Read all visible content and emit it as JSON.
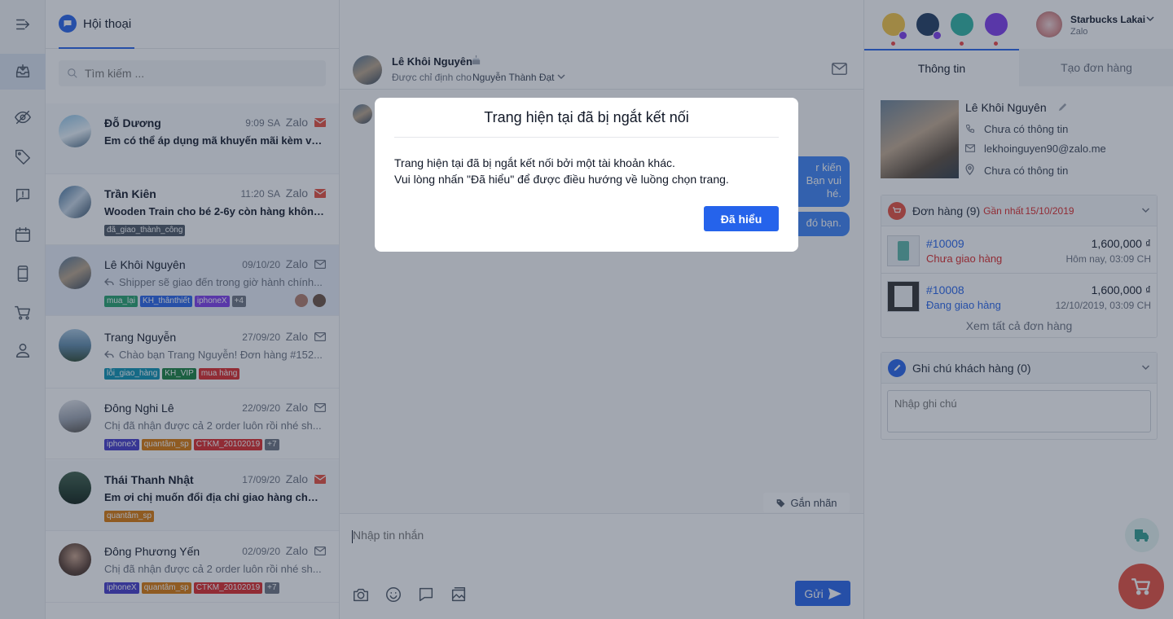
{
  "header": {
    "tab_label": "Hội thoại",
    "account_name": "Starbucks Lakai",
    "account_channel": "Zalo"
  },
  "search": {
    "placeholder": "Tìm kiếm ..."
  },
  "conversations": [
    {
      "name": "Đỗ Dương",
      "time": "9:09 SA",
      "source": "Zalo",
      "message": "Em có thể áp dụng mã khuyến mãi kèm với...",
      "unread": true,
      "tags": []
    },
    {
      "name": "Trần Kiên",
      "time": "11:20 SA",
      "source": "Zalo",
      "message": "Wooden Train cho bé 2-6y còn hàng không...",
      "unread": true,
      "tags": [
        "đã_giao_thành_công"
      ]
    },
    {
      "name": "Lê Khôi Nguyên",
      "time": "09/10/20",
      "source": "Zalo",
      "message": "Shipper sẽ giao đến trong giờ hành chính...",
      "unread": false,
      "tags": [
        "mua_lại",
        "KH_thânthiết",
        "iphoneX",
        "+4"
      ]
    },
    {
      "name": "Trang Nguyễn",
      "time": "27/09/20",
      "source": "Zalo",
      "message": "Chào bạn Trang Nguyễn! Đơn hàng #152...",
      "unread": false,
      "tags": [
        "lỗi_giao_hàng",
        "KH_VIP",
        "mua hàng"
      ]
    },
    {
      "name": "Đông Nghi Lê",
      "time": "22/09/20",
      "source": "Zalo",
      "message": "Chị đã nhận được cả 2 order luôn rồi nhé sh...",
      "unread": false,
      "tags": [
        "iphoneX",
        "quantâm_sp",
        "CTKM_20102019",
        "+7"
      ]
    },
    {
      "name": "Thái Thanh Nhật",
      "time": "17/09/20",
      "source": "Zalo",
      "message": "Em ơi chị muốn đổi địa chỉ giao hàng cho đơ...",
      "unread": true,
      "tags": [
        "quantâm_sp"
      ]
    },
    {
      "name": "Đông Phương Yến",
      "time": "02/09/20",
      "source": "Zalo",
      "message": "Chị đã nhận được cả 2 order luôn rồi nhé sh...",
      "unread": false,
      "tags": [
        "iphoneX",
        "quantâm_sp",
        "CTKM_20102019",
        "+7"
      ]
    }
  ],
  "chat": {
    "contact_name": "Lê Khôi Nguyên",
    "assigned_prefix": "Được chỉ định cho",
    "assigned_to": "Nguyễn Thành Đạt",
    "bubble1": "r kiến\nBạn vui\nhé.",
    "bubble2": "đó bạn.",
    "tag_button": "Gắn nhãn",
    "input_placeholder": "Nhập tin nhắn",
    "send_label": "Gửi"
  },
  "right_panel": {
    "tabs": [
      "Thông tin",
      "Tạo đơn hàng"
    ],
    "name": "Lê Khôi Nguyên",
    "phone": "Chưa có thông tin",
    "email": "lekhoinguyen90@zalo.me",
    "address": "Chưa có thông tin",
    "orders_title": "Đơn hàng (9)",
    "orders_recent_label": "Gần nhất",
    "orders_recent_date": "15/10/2019",
    "orders": [
      {
        "id": "#10009",
        "amount": "1,600,000 ₫",
        "status": "Chưa giao hàng",
        "date": "Hôm nay, 03:09 CH"
      },
      {
        "id": "#10008",
        "amount": "1,600,000 ₫",
        "status": "Đang giao hàng",
        "date": "12/10/2019, 03:09 CH"
      }
    ],
    "view_all": "Xem tất cả đơn hàng",
    "notes_title": "Ghi chú khách hàng (0)",
    "notes_placeholder": "Nhập ghi chú"
  },
  "modal": {
    "title": "Trang hiện tại đã bị ngắt kết nối",
    "line1": "Trang hiện tại đã bị ngắt kết nối bởi một tài khoản khác.",
    "line2": "Vui lòng nhấn \"Đã hiểu\" để được điều hướng về luồng chọn trang.",
    "button": "Đã hiểu"
  },
  "colors": {
    "primary": "#2563eb",
    "danger": "#dc2626",
    "overlay": "rgba(40,52,74,0.42)"
  }
}
